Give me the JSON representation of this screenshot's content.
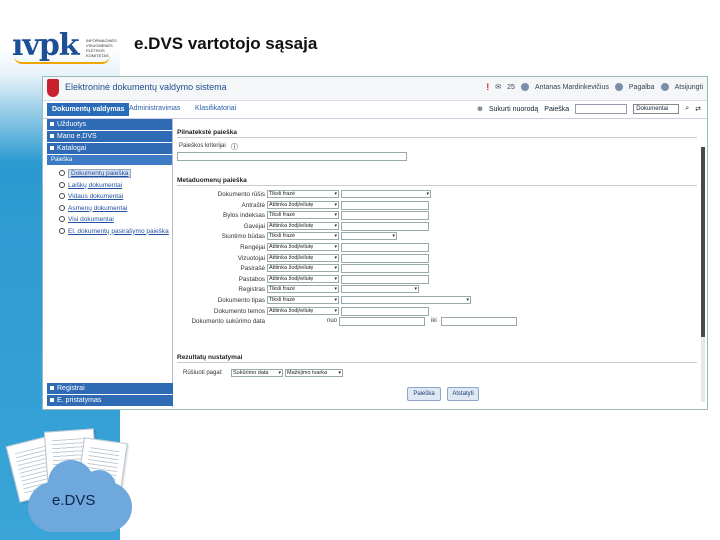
{
  "slide": {
    "logo_text": "ıvpk",
    "logo_sub": "INFORMACINĖS VISUOMENĖS PLĖTROS KOMITETAS",
    "title": "e.DVS vartotojo sąsaja",
    "cloud_label": "e.DVS"
  },
  "app": {
    "system_name": "Elektroninė dokumentų valdymo sistema",
    "header_alert": "!",
    "header_count": "25",
    "user_name": "Antanas Mardinkevičius",
    "help_label": "Pagalba",
    "logout_label": "Atsijungti",
    "tabs": [
      "Dokumentų valdymas",
      "Administravimas",
      "Klasifikatoriai"
    ],
    "toolbar": {
      "create_link": "Sukurti nuorodą",
      "search_label": "Paieška",
      "doc_select": "Dokumentai"
    }
  },
  "sidebar": {
    "top_items": [
      "Užduotys",
      "Mano e.DVS",
      "Katalogai"
    ],
    "section_header": "Paieška",
    "search_items": [
      "Dokumentų paieška",
      "Laiškų dokumentai",
      "Vidaus dokumentai",
      "Asmenų dokumentai",
      "Visi dokumentai",
      "El. dokumentų pasirašymo paieška"
    ],
    "bottom_items": [
      "Registrai",
      "E. pristatymas"
    ]
  },
  "search": {
    "fulltext_title": "Pilnatekstė paieška",
    "criteria_label": "Paieškos kriterijai",
    "metadata_title": "Metaduomenų paieška",
    "rows": [
      {
        "label": "Dokumento rūšis",
        "select": "Tiksli frazė"
      },
      {
        "label": "Antraštė",
        "select": "Atitinka žodį/eilutę"
      },
      {
        "label": "Bylos indeksas",
        "select": "Tiksli frazė"
      },
      {
        "label": "Gavėjai",
        "select": "Atitinka žodį/eilutę"
      },
      {
        "label": "Siuntimo būdas",
        "select": "Tiksli frazė"
      },
      {
        "label": "Rengėjai",
        "select": "Atitinka žodį/eilutę"
      },
      {
        "label": "Vizuotojai",
        "select": "Atitinka žodį/eilutę"
      },
      {
        "label": "Pasirašė",
        "select": "Atitinka žodį/eilutę"
      },
      {
        "label": "Pastabos",
        "select": "Atitinka žodį/eilutę"
      },
      {
        "label": "Registras",
        "select": "Tiksli frazė"
      },
      {
        "label": "Dokumento tipas",
        "select": "Tiksli frazė"
      },
      {
        "label": "Dokumento temos",
        "select": "Atitinka žodį/eilutę"
      },
      {
        "label": "Dokumento sukūrimo data",
        "from": "nuo",
        "to": "iki"
      }
    ],
    "results_title": "Rezultatų nustatymai",
    "sort_label": "Rūšiuoti pagal:",
    "sort_field": "Sukūrimo data",
    "sort_order": "Mažėjimo tvarka",
    "search_button": "Paieška",
    "reset_button": "Atstatyti"
  },
  "colors": {
    "accent": "#2f6bb5",
    "band": "#3aa4d8"
  }
}
